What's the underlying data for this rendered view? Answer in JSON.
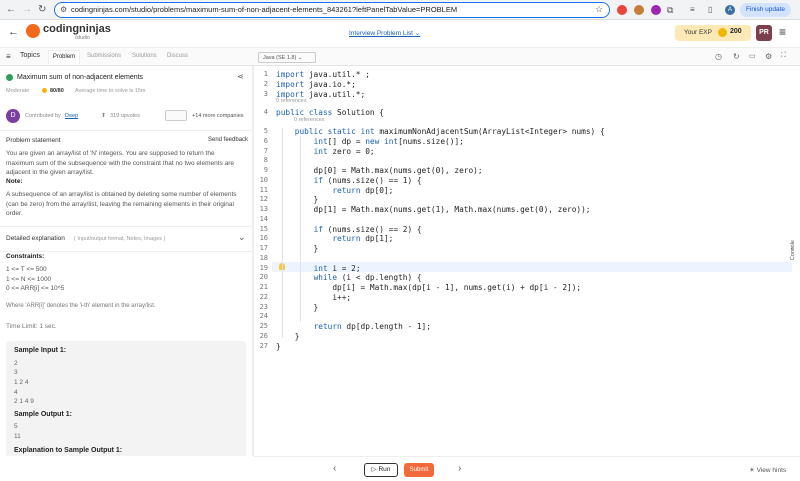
{
  "browser": {
    "url": "codingninjas.com/studio/problems/maximum-sum-of-non-adjacent-elements_843261?leftPanelTabValue=PROBLEM",
    "finish_update": "Finish update",
    "profile_initial": "A"
  },
  "header": {
    "logo_name": "codingninjas",
    "logo_sub": "/studio",
    "interview_list": "Interview Problem List",
    "your_exp_label": "Your EXP",
    "exp_value": "200",
    "avatar_initials": "PR"
  },
  "tabs": {
    "topics": "Topics",
    "problem": "Problem",
    "submissions": "Submissions",
    "solutions": "Solutions",
    "discuss": "Discuss"
  },
  "problem": {
    "title": "Maximum sum of non-adjacent elements",
    "difficulty": "Moderate",
    "score": "80/80",
    "avg_time": "Average time to solve is 15m",
    "contributed_by_label": "Contributed by",
    "contributor": "Deep",
    "contributor_initial": "D",
    "upvotes": "319 upvotes",
    "more_companies": "+14 more companies",
    "statement_heading": "Problem statement",
    "send_feedback": "Send feedback",
    "statement": "You are given an array/list of 'N' integers. You are supposed to return the maximum sum of the subsequence with the constraint that no two elements are adjacent in the given array/list.",
    "note_label": "Note:",
    "note": "A subsequence of an array/list is obtained by deleting some number of elements (can be zero) from the array/list, leaving the remaining elements in their original order.",
    "detailed_label": "Detailed explanation",
    "detailed_sub": "( Input/output format, Notes, Images )",
    "constraints_label": "Constraints:",
    "constraints": [
      "1 <= T <= 500",
      "1 <= N <= 1000",
      "0 <= ARR[i] <= 10^5"
    ],
    "where_note": "Where 'ARR[i]' denotes the 'i-th' element in the array/list.",
    "time_limit": "Time Limit: 1 sec.",
    "sample_input_label": "Sample Input 1:",
    "sample_input": [
      "2",
      "3",
      "1 2 4",
      "4",
      "2 1 4 9"
    ],
    "sample_output_label": "Sample Output 1:",
    "sample_output": [
      "5",
      "11"
    ],
    "explanation_label": "Explanation to Sample Output 1:"
  },
  "editor": {
    "language": "Java (SE 1.8)",
    "refs_label": "0 references",
    "lines": [
      "import java.util.* ;",
      "import java.io.*;",
      "import java.util.*;",
      "public class Solution {",
      "    public static int maximumNonAdjacentSum(ArrayList<Integer> nums) {",
      "        int[] dp = new int[nums.size()];",
      "        int zero = 0;",
      "",
      "        dp[0] = Math.max(nums.get(0), zero);",
      "        if (nums.size() == 1) {",
      "            return dp[0];",
      "        }",
      "        dp[1] = Math.max(nums.get(1), Math.max(nums.get(0), zero));",
      "",
      "        if (nums.size() == 2) {",
      "            return dp[1];",
      "        }",
      "",
      "        int i = 2;",
      "        while (i < dp.length) {",
      "            dp[i] = Math.max(dp[i - 1], nums.get(i) + dp[i - 2]);",
      "            i++;",
      "        }",
      "",
      "        return dp[dp.length - 1];",
      "    }",
      "}"
    ]
  },
  "footer": {
    "run": "Run",
    "submit": "Submit",
    "view_hints": "View hints",
    "console": "Console"
  },
  "colors": {
    "accent": "#f26a1b",
    "link": "#1a5fb4",
    "submit": "#f26a3b"
  }
}
